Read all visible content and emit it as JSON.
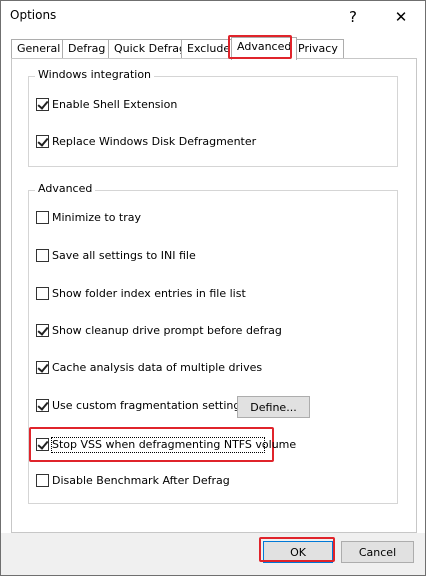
{
  "window": {
    "title": "Options",
    "help_glyph": "?",
    "close_glyph": "✕"
  },
  "tabs": [
    {
      "label": "General"
    },
    {
      "label": "Defrag"
    },
    {
      "label": "Quick Defrag"
    },
    {
      "label": "Exclude"
    },
    {
      "label": "Advanced"
    },
    {
      "label": "Privacy"
    }
  ],
  "active_tab": "Advanced",
  "windows_integration": {
    "label": "Windows integration",
    "items": [
      {
        "label": "Enable Shell Extension",
        "checked": true
      },
      {
        "label": "Replace Windows Disk Defragmenter",
        "checked": true
      }
    ]
  },
  "advanced": {
    "label": "Advanced",
    "items": [
      {
        "label": "Minimize to tray",
        "checked": false
      },
      {
        "label": "Save all settings to INI file",
        "checked": false
      },
      {
        "label": "Show folder index entries in file list",
        "checked": false
      },
      {
        "label": "Show cleanup drive prompt before defrag",
        "checked": true
      },
      {
        "label": "Cache analysis data of multiple drives",
        "checked": true
      },
      {
        "label": "Use custom fragmentation settings:",
        "checked": true
      },
      {
        "label": "Stop VSS when defragmenting NTFS volume",
        "checked": true
      },
      {
        "label": "Disable Benchmark After Defrag",
        "checked": false
      }
    ],
    "define_label": "Define..."
  },
  "footer": {
    "ok_label": "OK",
    "cancel_label": "Cancel"
  },
  "colors": {
    "highlight": "#e0242b",
    "focus_border": "#0078d7"
  }
}
